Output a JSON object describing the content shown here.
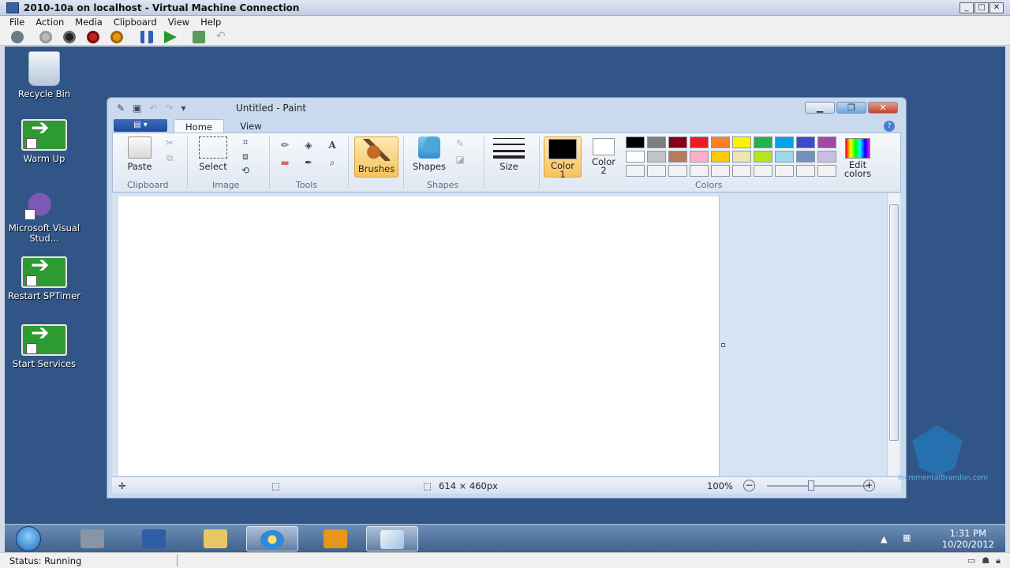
{
  "vm": {
    "title": "2010-10a on localhost - Virtual Machine Connection",
    "menu": [
      "File",
      "Action",
      "Media",
      "Clipboard",
      "View",
      "Help"
    ],
    "status": "Status: Running"
  },
  "desktop": {
    "icons": [
      {
        "label": "Recycle Bin",
        "icon": "recycle-bin-icon"
      },
      {
        "label": "Warm Up",
        "icon": "arrow-shortcut-icon"
      },
      {
        "label": "Microsoft Visual Stud...",
        "icon": "visual-studio-icon"
      },
      {
        "label": "Restart SPTimer",
        "icon": "arrow-shortcut-icon"
      },
      {
        "label": "Start Services",
        "icon": "arrow-shortcut-icon"
      }
    ]
  },
  "paint": {
    "title": "Untitled - Paint",
    "tabs": [
      "Home",
      "View"
    ],
    "groups": {
      "clipboard": "Clipboard",
      "image": "Image",
      "tools": "Tools",
      "shapes": "Shapes",
      "colors": "Colors"
    },
    "buttons": {
      "paste": "Paste",
      "select": "Select",
      "brushes": "Brushes",
      "shapes": "Shapes",
      "size": "Size",
      "color1_a": "Color",
      "color1_b": "1",
      "color2_a": "Color",
      "color2_b": "2",
      "edit_colors_a": "Edit",
      "edit_colors_b": "colors"
    },
    "palette": [
      "#000000",
      "#7f7f7f",
      "#880015",
      "#ed1c24",
      "#ff7f27",
      "#fff200",
      "#22b14c",
      "#00a2e8",
      "#3f48cc",
      "#a349a4",
      "#ffffff",
      "#c3c3c3",
      "#b97a57",
      "#ffaec9",
      "#ffc90e",
      "#efe4b0",
      "#b5e61d",
      "#99d9ea",
      "#7092be",
      "#c8bfe7",
      "#f2f2f2",
      "#f2f2f2",
      "#f2f2f2",
      "#f2f2f2",
      "#f2f2f2",
      "#f2f2f2",
      "#f2f2f2",
      "#f2f2f2",
      "#f2f2f2",
      "#f2f2f2"
    ],
    "color1": "#000000",
    "color2": "#ffffff",
    "status": {
      "dimensions": "614 × 460px",
      "zoom": "100%"
    }
  },
  "taskbar": {
    "time": "1:31 PM",
    "date": "10/20/2012"
  },
  "watermark": {
    "text": "IncrementalBrandon.com"
  }
}
